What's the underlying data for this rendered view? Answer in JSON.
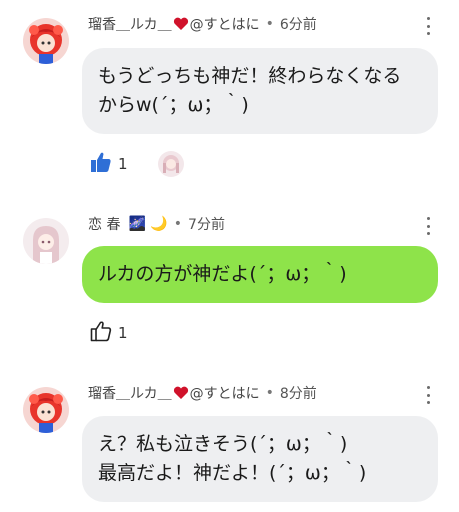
{
  "comments": [
    {
      "author": "瑠香＿ルカ＿",
      "author_suffix": "@すとはに",
      "separator": "•",
      "time": "6分前",
      "lines": [
        "もうどっちも神だ！終わらなくなる",
        "からw(´；ω；｀)"
      ],
      "likes": "1",
      "liked": true
    },
    {
      "author": "恋 春",
      "author_suffix": "🌌 🌙",
      "separator": "•",
      "time": "7分前",
      "lines": [
        "ルカの方が神だよ(´；ω；｀)"
      ],
      "likes": "1",
      "liked": false
    },
    {
      "author": "瑠香＿ルカ＿",
      "author_suffix": "@すとはに",
      "separator": "•",
      "time": "8分前",
      "lines": [
        "え？私も泣きそう(´；ω；｀)",
        "最高だよ！神だよ！(´；ω；｀)"
      ]
    }
  ],
  "colors": {
    "gray_bubble": "#eeeff1",
    "green_bubble": "#8ee34a",
    "like_active": "#2f6fd6",
    "heart": "#d0122b"
  },
  "icons": [
    "heart-icon",
    "more-vert-icon",
    "thumbs-up-icon",
    "avatar"
  ]
}
